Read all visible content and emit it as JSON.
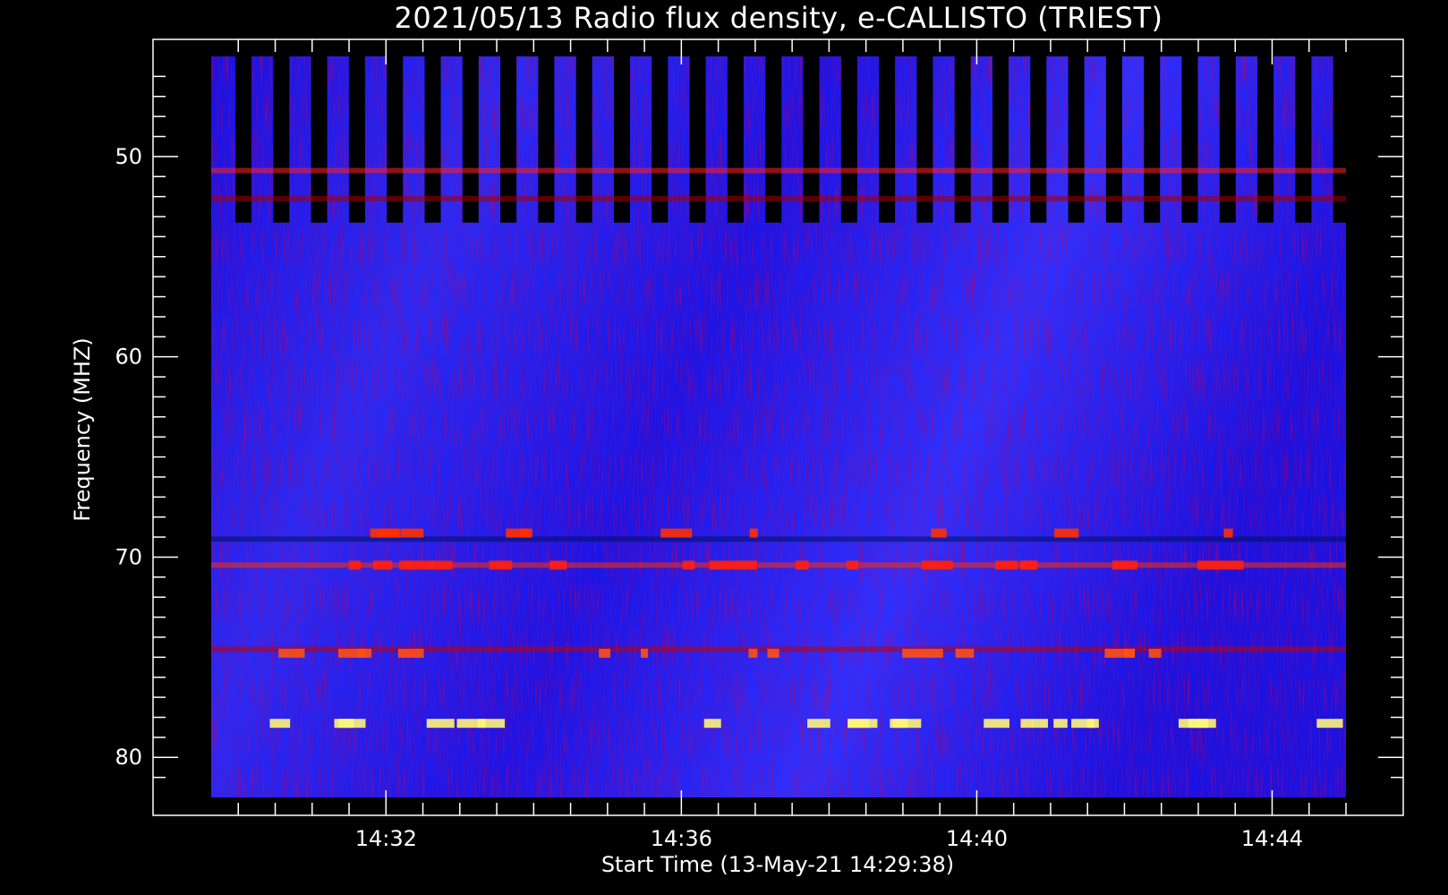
{
  "chart_data": {
    "type": "heatmap",
    "title": "2021/05/13  Radio flux density, e-CALLISTO (TRIEST)",
    "xlabel": "Start Time (13-May-21 14:29:38)",
    "ylabel": "Frequency (MHZ)",
    "x_ticks": [
      "14:32",
      "14:36",
      "14:40",
      "14:44"
    ],
    "y_ticks": [
      50,
      60,
      70,
      80
    ],
    "ylim": [
      45,
      82
    ],
    "y_inverted": true,
    "xlim_minutes": [
      "14:29:38",
      "14:45:00"
    ],
    "colormap": [
      "#000000",
      "#0000ff",
      "#8b0000",
      "#ff0000",
      "#ffff00",
      "#ffffff"
    ],
    "interference_lines_mhz": [
      50.7,
      52.1,
      69.1,
      70.4,
      74.6,
      78.3
    ],
    "background_color": "#000000",
    "plot_color": "#ffffff"
  }
}
